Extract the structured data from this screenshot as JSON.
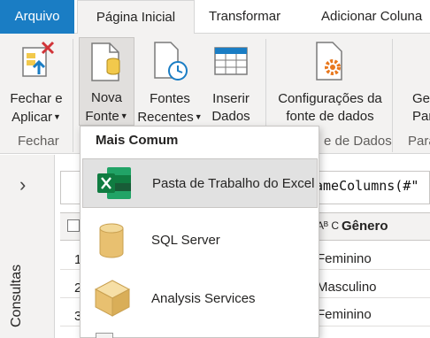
{
  "tabs": {
    "file": "Arquivo",
    "home": "Página Inicial",
    "transform": "Transformar",
    "add_column": "Adicionar Coluna"
  },
  "ribbon": {
    "close_apply_line1": "Fechar e",
    "close_apply_line2": "Aplicar",
    "new_source_line1": "Nova",
    "new_source_line2": "Fonte",
    "recent_sources_line1": "Fontes",
    "recent_sources_line2": "Recentes",
    "enter_data_line1": "Inserir",
    "enter_data_line2": "Dados",
    "data_source_settings_line1": "Configurações da",
    "data_source_settings_line2": "fonte de dados",
    "manage_params_line1": "Ge",
    "manage_params_line2": "Parâ",
    "group_close": "Fechar",
    "group_data_sources": "e de Dados",
    "group_params": "Parâ"
  },
  "queries_pane": {
    "label": "Consultas"
  },
  "formula_bar": {
    "text": "ameColumns(#\""
  },
  "grid": {
    "column_type": "Aᴮ C",
    "column_name": "Gênero",
    "rows": [
      {
        "num": "1",
        "value": "Feminino"
      },
      {
        "num": "2",
        "value": "Masculino"
      },
      {
        "num": "3",
        "value": "Feminino"
      }
    ]
  },
  "dropdown": {
    "header": "Mais Comum",
    "items": [
      {
        "label": "Pasta de Trabalho do Excel",
        "icon": "excel-icon"
      },
      {
        "label": "SQL Server",
        "icon": "database-icon"
      },
      {
        "label": "Analysis Services",
        "icon": "cube-icon"
      }
    ]
  },
  "colors": {
    "accent": "#1a7dc4",
    "excel_green": "#107c41",
    "db_gold": "#e8c070",
    "gear_orange": "#e8781e"
  }
}
